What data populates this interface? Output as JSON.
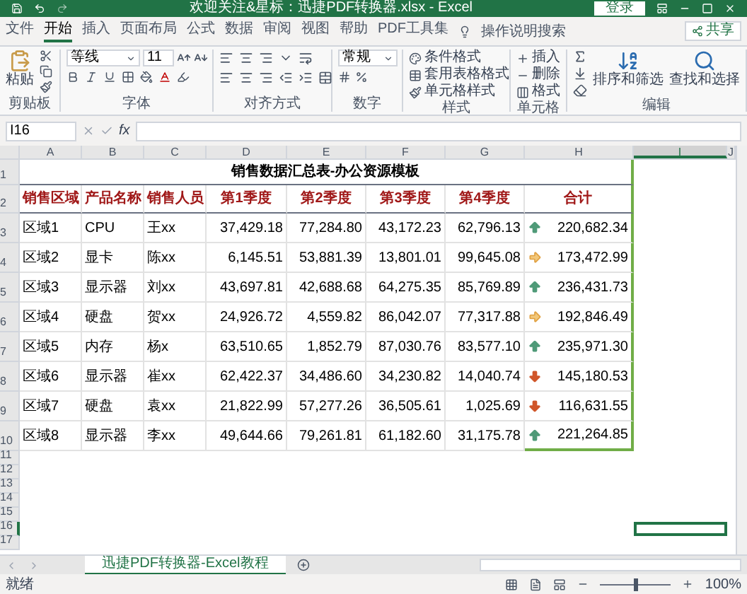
{
  "window": {
    "title": "欢迎关注&星标：迅捷PDF转换器.xlsx  -  Excel",
    "login_button": "登录"
  },
  "menu_tabs": [
    {
      "label": "文件",
      "selected": false
    },
    {
      "label": "开始",
      "selected": true
    },
    {
      "label": "插入",
      "selected": false
    },
    {
      "label": "页面布局",
      "selected": false
    },
    {
      "label": "公式",
      "selected": false
    },
    {
      "label": "数据",
      "selected": false
    },
    {
      "label": "审阅",
      "selected": false
    },
    {
      "label": "视图",
      "selected": false
    },
    {
      "label": "帮助",
      "selected": false
    },
    {
      "label": "PDF工具集",
      "selected": false
    }
  ],
  "search": {
    "placeholder": "操作说明搜索"
  },
  "share_button": "共享",
  "ribbon": {
    "clipboard": {
      "paste": "粘贴",
      "label": "剪贴板"
    },
    "font": {
      "name": "等线",
      "size": "11",
      "label": "字体"
    },
    "alignment": {
      "label": "对齐方式"
    },
    "number": {
      "format": "常规",
      "label": "数字"
    },
    "styles": {
      "items": [
        "条件格式",
        "套用表格格式",
        "单元格样式"
      ],
      "label": "样式"
    },
    "cells": {
      "items": [
        "插入",
        "删除",
        "格式"
      ],
      "label": "单元格"
    },
    "editing": {
      "sort": "排序和筛选",
      "find": "查找和选择",
      "label": "编辑"
    }
  },
  "formula_bar": {
    "name_box": "I16",
    "function_label": "fx"
  },
  "columns": [
    {
      "label": "A",
      "selected": false
    },
    {
      "label": "B",
      "selected": false
    },
    {
      "label": "C",
      "selected": false
    },
    {
      "label": "D",
      "selected": false
    },
    {
      "label": "E",
      "selected": false
    },
    {
      "label": "F",
      "selected": false
    },
    {
      "label": "G",
      "selected": false
    },
    {
      "label": "H",
      "selected": false
    },
    {
      "label": "I",
      "selected": true
    },
    {
      "label": "J",
      "selected": false
    }
  ],
  "row_headers": [
    {
      "label": "1",
      "selected": false
    },
    {
      "label": "2",
      "selected": false
    },
    {
      "label": "3",
      "selected": false
    },
    {
      "label": "4",
      "selected": false
    },
    {
      "label": "5",
      "selected": false
    },
    {
      "label": "6",
      "selected": false
    },
    {
      "label": "7",
      "selected": false
    },
    {
      "label": "8",
      "selected": false
    },
    {
      "label": "9",
      "selected": false
    },
    {
      "label": "10",
      "selected": false
    },
    {
      "label": "11",
      "selected": false
    },
    {
      "label": "12",
      "selected": false
    },
    {
      "label": "13",
      "selected": false
    },
    {
      "label": "14",
      "selected": false
    },
    {
      "label": "15",
      "selected": false
    },
    {
      "label": "16",
      "selected": true
    },
    {
      "label": "17",
      "selected": false
    }
  ],
  "sheet": {
    "title": "销售数据汇总表-办公资源模板",
    "headers": [
      "销售区域",
      "产品名称",
      "销售人员",
      "第1季度",
      "第2季度",
      "第3季度",
      "第4季度",
      "合计"
    ],
    "rows": [
      {
        "cells": [
          "区域1",
          "CPU",
          "王xx",
          "37,429.18",
          "77,284.80",
          "43,172.23",
          "62,796.13"
        ],
        "kind": "up",
        "total": "220,682.34"
      },
      {
        "cells": [
          "区域2",
          "显卡",
          "陈xx",
          "6,145.51",
          "53,881.39",
          "13,801.01",
          "99,645.08"
        ],
        "kind": "flat",
        "total": "173,472.99"
      },
      {
        "cells": [
          "区域3",
          "显示器",
          "刘xx",
          "43,697.81",
          "42,688.68",
          "64,275.35",
          "85,769.89"
        ],
        "kind": "up",
        "total": "236,431.73"
      },
      {
        "cells": [
          "区域4",
          "硬盘",
          "贺xx",
          "24,926.72",
          "4,559.82",
          "86,042.07",
          "77,317.88"
        ],
        "kind": "flat",
        "total": "192,846.49"
      },
      {
        "cells": [
          "区域5",
          "内存",
          "杨x",
          "63,510.65",
          "1,852.79",
          "87,030.76",
          "83,577.10"
        ],
        "kind": "up",
        "total": "235,971.30"
      },
      {
        "cells": [
          "区域6",
          "显示器",
          "崔xx",
          "62,422.37",
          "34,486.60",
          "34,230.82",
          "14,040.74"
        ],
        "kind": "down",
        "total": "145,180.53"
      },
      {
        "cells": [
          "区域7",
          "硬盘",
          "袁xx",
          "21,822.99",
          "57,277.26",
          "36,505.61",
          "1,025.69"
        ],
        "kind": "down",
        "total": "116,631.55"
      },
      {
        "cells": [
          "区域8",
          "显示器",
          "李xx",
          "49,644.66",
          "79,261.81",
          "61,182.60",
          "31,175.78"
        ],
        "kind": "up",
        "total": "221,264.85"
      }
    ]
  },
  "sheet_tabs": [
    {
      "label": "迅捷PDF转换器-Excel教程",
      "selected": true
    }
  ],
  "status_bar": {
    "status": "就绪",
    "zoom": "100%",
    "level": 0.5
  }
}
